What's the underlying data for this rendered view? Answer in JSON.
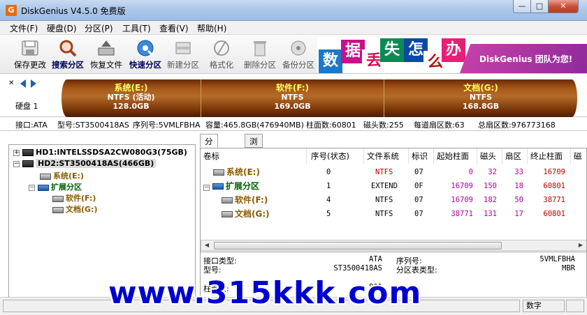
{
  "window": {
    "title": "DiskGenius V4.5.0 免费版",
    "icon_letter": "G",
    "min": "—",
    "max": "□",
    "close": "✕"
  },
  "menu": [
    "文件(F)",
    "硬盘(D)",
    "分区(P)",
    "工具(T)",
    "查看(V)",
    "帮助(H)"
  ],
  "toolbar": [
    {
      "label": "保存更改",
      "icon": "save-icon",
      "state": "normal"
    },
    {
      "label": "搜索分区",
      "icon": "search-partition-icon",
      "state": "active"
    },
    {
      "label": "恢复文件",
      "icon": "recover-file-icon",
      "state": "normal"
    },
    {
      "label": "快速分区",
      "icon": "quick-partition-icon",
      "state": "active"
    },
    {
      "label": "新建分区",
      "icon": "new-partition-icon",
      "state": "disabled"
    },
    {
      "label": "格式化",
      "icon": "format-icon",
      "state": "disabled"
    },
    {
      "label": "删除分区",
      "icon": "delete-partition-icon",
      "state": "disabled"
    },
    {
      "label": "备份分区",
      "icon": "backup-partition-icon",
      "state": "disabled"
    }
  ],
  "banner": {
    "tiles": [
      "数",
      "据",
      "丢",
      "失",
      "怎",
      "么",
      "办"
    ],
    "slogan": "DiskGenius 团队为您!"
  },
  "disk": {
    "label": "硬盘 1",
    "partitions": [
      {
        "name": "系统(E:)",
        "fs": "NTFS (活动)",
        "size": "128.0GB"
      },
      {
        "name": "软件(F:)",
        "fs": "NTFS",
        "size": "169.0GB"
      },
      {
        "name": "文档(G:)",
        "fs": "NTFS",
        "size": "168.8GB"
      }
    ]
  },
  "info": [
    "接口:ATA",
    "型号:ST3500418AS",
    "序列号:5VMLFBHA",
    "容量:465.8GB(476940MB)",
    "柱面数:60801",
    "磁头数:255",
    "每道扇区数:63",
    "总扇区数:976773168"
  ],
  "tree": {
    "hd1": "HD1:INTELSSDSA2CW080G3(75GB)",
    "hd2": "HD2:ST3500418AS(466GB)",
    "sys": "系统(E:)",
    "ext": "扩展分区",
    "soft": "软件(F:)",
    "doc": "文档(G:)"
  },
  "tabs": [
    "分区参数",
    "浏览文件"
  ],
  "table": {
    "headers": [
      "卷标",
      "序号(状态)",
      "文件系统",
      "标识",
      "起始柱面",
      "磁头",
      "扇区",
      "终止柱面",
      "磁"
    ],
    "rows": [
      {
        "name": "系统(E:)",
        "seq": "0",
        "fs": "NTFS",
        "id": "07",
        "start": "0",
        "head": "32",
        "sector": "33",
        "end": "16709"
      },
      {
        "name": "扩展分区",
        "seq": "1",
        "fs": "EXTEND",
        "id": "0F",
        "start": "16709",
        "head": "150",
        "sector": "18",
        "end": "60801"
      },
      {
        "name": "软件(F:)",
        "seq": "4",
        "fs": "NTFS",
        "id": "07",
        "start": "16709",
        "head": "182",
        "sector": "50",
        "end": "38771"
      },
      {
        "name": "文档(G:)",
        "seq": "5",
        "fs": "NTFS",
        "id": "07",
        "start": "38771",
        "head": "131",
        "sector": "17",
        "end": "60801"
      }
    ]
  },
  "details": {
    "iface_label": "接口类型:",
    "iface_val": "ATA",
    "model_label": "型号:",
    "model_val": "ST3500418AS",
    "serial_label": "序列号:",
    "serial_val": "5VMLFBHA",
    "ptype_label": "分区表类型:",
    "ptype_val": "MBR",
    "cyl_label": "柱面数:",
    "cyl_val": "801"
  },
  "status": {
    "numlock": "数字"
  },
  "watermark": "www.315kkk.com"
}
